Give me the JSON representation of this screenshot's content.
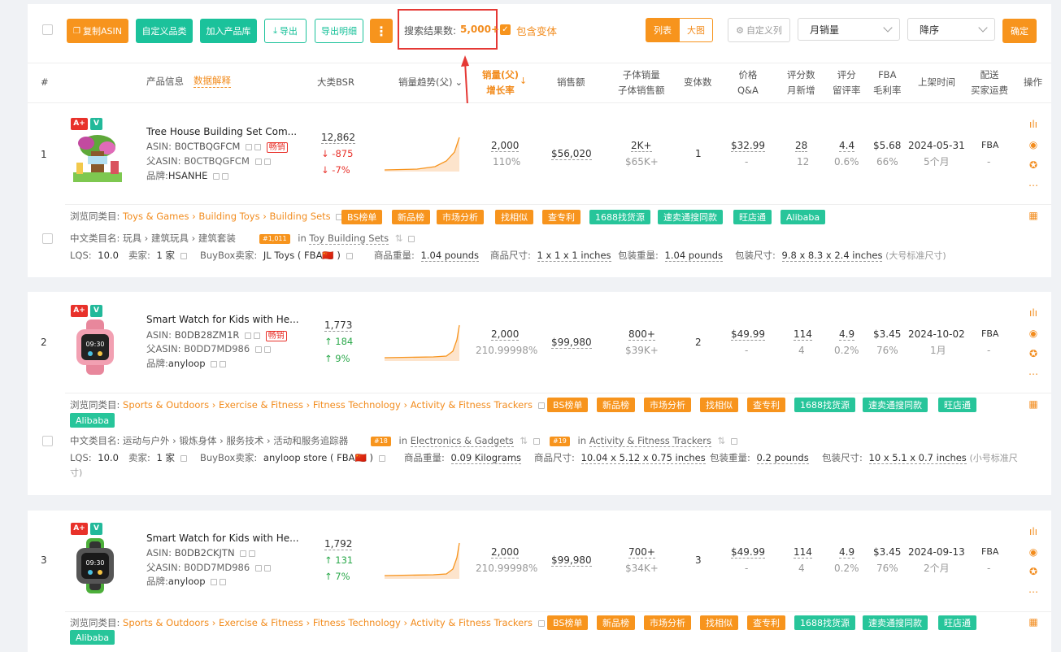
{
  "toolbar": {
    "copy_asin": "复制ASIN",
    "custom_category": "自定义品类",
    "add_to_library": "加入产品库",
    "export": "导出",
    "export_detail": "导出明细",
    "more": "⋮",
    "result_label": "搜索结果数:",
    "result_value": "5,000+",
    "include_variants": "包含变体",
    "view_list": "列表",
    "view_grid": "大图",
    "custom_columns": "自定义列",
    "sort_field": "月销量",
    "sort_order": "降序",
    "confirm": "确定"
  },
  "headers": {
    "num": "#",
    "product_info": "产品信息",
    "data_explain": "数据解释",
    "bsr": "大类BSR",
    "sales_trend": "销量趋势(父)",
    "sales_parent_1": "销量(父)",
    "sales_parent_2": "增长率",
    "revenue": "销售额",
    "child_sales_1": "子体销量",
    "child_sales_2": "子体销售额",
    "variants": "变体数",
    "price_1": "价格",
    "price_2": "Q&A",
    "ratings_1": "评分数",
    "ratings_2": "月新增",
    "rating_1": "评分",
    "rating_2": "留评率",
    "fba_1": "FBA",
    "fba_2": "毛利率",
    "listed": "上架时间",
    "ship_1": "配送",
    "ship_2": "买家运费",
    "ops": "操作"
  },
  "labels": {
    "asin": "ASIN:",
    "parent_asin": "父ASIN:",
    "brand": "品牌:",
    "hot": "畅销",
    "browse": "浏览同类目:",
    "cn_category": "中文类目名:",
    "lqs": "LQS:",
    "sellers": "卖家:",
    "buybox": "BuyBox卖家:",
    "item_weight": "商品重量:",
    "item_size": "商品尺寸:",
    "pkg_weight": "包装重量:",
    "pkg_size": "包装尺寸:",
    "in": "in",
    "badge_aplus": "A+",
    "badge_v": "V"
  },
  "tags": [
    "BS榜单",
    "新品榜",
    "市场分析",
    "找相似",
    "查专利",
    "1688找货源",
    "速卖通搜同款",
    "旺店通",
    "Alibaba"
  ],
  "products": [
    {
      "num": "1",
      "title": "Tree House Building Set Com...",
      "asin": "B0CTBQGFCM",
      "parent_asin": "B0CTBQGFCM",
      "brand": "HSANHE",
      "hot": true,
      "bsr": "12,862",
      "bsr_change": "↓ -875",
      "bsr_pct": "↓ -7%",
      "trend": "down",
      "sales": "2,000",
      "growth": "110%",
      "revenue": "$56,020",
      "child_sales": "2K+",
      "child_revenue": "$65K+",
      "variants": "1",
      "price": "$32.99",
      "qa": "-",
      "ratings": "28",
      "ratings_new": "12",
      "rating": "4.4",
      "review_rate": "0.6%",
      "fba": "$5.68",
      "margin": "66%",
      "listed": "2024-05-31",
      "listed_age": "5个月",
      "ship": "FBA",
      "ship_fee": "-",
      "browse_path": "Toys & Games › Building Toys › Building Sets",
      "cn_path": "玩具 › 建筑玩具 › 建筑套装",
      "cn_rank1": "#1,011",
      "cn_cat1": "Toy Building Sets",
      "lqs": "10.0",
      "sellers": "1 家",
      "buybox": "JL Toys ( FBA🇨🇳 )",
      "item_weight": "1.04 pounds",
      "item_size": "1 x 1 x 1 inches",
      "pkg_weight": "1.04 pounds",
      "pkg_size": "9.8 x 8.3 x 2.4 inches",
      "pkg_note": "(大号标准尺寸)"
    },
    {
      "num": "2",
      "title": "Smart Watch for Kids with He...",
      "asin": "B0DB28ZM1R",
      "parent_asin": "B0DD7MD986",
      "brand": "anyloop",
      "hot": true,
      "bsr": "1,773",
      "bsr_change": "↑ 184",
      "bsr_pct": "↑ 9%",
      "trend": "up",
      "sales": "2,000",
      "growth": "210.99998%",
      "revenue": "$99,980",
      "child_sales": "800+",
      "child_revenue": "$39K+",
      "variants": "2",
      "price": "$49.99",
      "qa": "-",
      "ratings": "114",
      "ratings_new": "4",
      "rating": "4.9",
      "review_rate": "0.2%",
      "fba": "$3.45",
      "margin": "76%",
      "listed": "2024-10-02",
      "listed_age": "1月",
      "ship": "FBA",
      "ship_fee": "-",
      "browse_path": "Sports & Outdoors › Exercise & Fitness › Fitness Technology › Activity & Fitness Trackers",
      "cn_path": "运动与户外 › 锻炼身体 › 服务技术 › 活动和服务追踪器",
      "cn_rank1": "#18",
      "cn_cat1": "Electronics & Gadgets",
      "cn_rank2": "#19",
      "cn_cat2": "Activity & Fitness Trackers",
      "lqs": "10.0",
      "sellers": "1 家",
      "buybox": "anyloop store ( FBA🇨🇳 )",
      "item_weight": "0.09 Kilograms",
      "item_size": "10.04 x 5.12 x 0.75 inches",
      "pkg_weight": "0.2 pounds",
      "pkg_size": "10 x 5.1 x 0.7 inches",
      "pkg_note": "(小号标准尺",
      "pkg_note2": "寸)"
    },
    {
      "num": "3",
      "title": "Smart Watch for Kids with He...",
      "asin": "B0DB2CKJTN",
      "parent_asin": "B0DD7MD986",
      "brand": "anyloop",
      "bsr": "1,792",
      "bsr_change": "↑ 131",
      "bsr_pct": "↑ 7%",
      "trend": "up",
      "sales": "2,000",
      "growth": "210.99998%",
      "revenue": "$99,980",
      "child_sales": "700+",
      "child_revenue": "$34K+",
      "variants": "3",
      "price": "$49.99",
      "qa": "-",
      "ratings": "114",
      "ratings_new": "4",
      "rating": "4.9",
      "review_rate": "0.2%",
      "fba": "$3.45",
      "margin": "76%",
      "listed": "2024-09-13",
      "listed_age": "2个月",
      "ship": "FBA",
      "ship_fee": "-",
      "browse_path": "Sports & Outdoors › Exercise & Fitness › Fitness Technology › Activity & Fitness Trackers"
    }
  ],
  "colors": {
    "orange": "#f7941d",
    "green": "#1bc29b",
    "red": "#e8312a",
    "highlight_box": "#e53935"
  }
}
